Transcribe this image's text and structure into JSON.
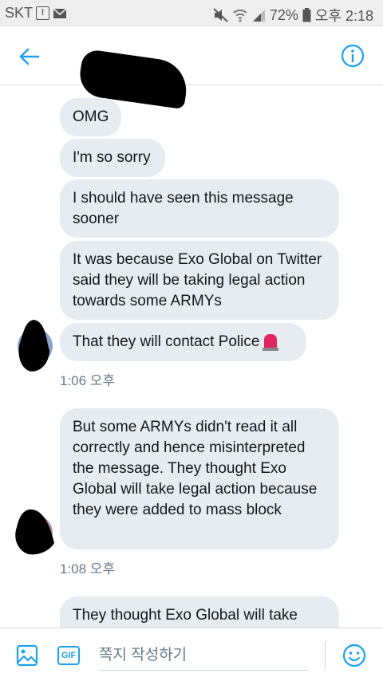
{
  "status_bar": {
    "carrier": "SKT",
    "alert_icon": "!",
    "battery_percent": "72%",
    "time": "오후 2:18"
  },
  "header": {
    "back_icon": "arrow-left-icon",
    "info_icon": "info-icon",
    "accent_color": "#1da1f2"
  },
  "messages": [
    {
      "text": "OMG"
    },
    {
      "text": "I'm so sorry"
    },
    {
      "text": "I should have seen this message sooner"
    },
    {
      "text": "It was because Exo Global on Twitter said they will be taking legal action towards some ARMYs"
    },
    {
      "text": "That they will contact Police",
      "emoji": "police-siren"
    },
    {
      "text": "But some ARMYs didn't read it all correctly and hence misinterpreted the message. They thought Exo Global will take legal action because they were added to mass block"
    },
    {
      "text": "They thought Exo Global will take"
    }
  ],
  "timestamps": [
    "1:06 오후",
    "1:08 오후"
  ],
  "composer": {
    "placeholder": "쪽지 작성하기",
    "gif_label": "GIF"
  }
}
